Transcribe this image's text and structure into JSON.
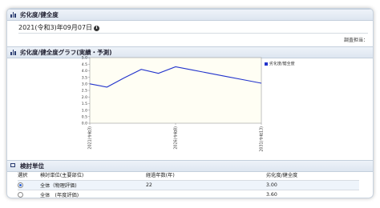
{
  "header": {
    "title": "劣化度/健全度"
  },
  "date_row": {
    "date": "2021(令和3)年09月07日",
    "info_icon": "info-icon"
  },
  "surveyor": {
    "label": "調査担当："
  },
  "chart_section": {
    "title": "劣化度/健全度グラフ(実績・予測)"
  },
  "chart_data": {
    "type": "line",
    "title": "",
    "xlabel": "",
    "ylabel": "",
    "x": [
      2021,
      2022,
      2023,
      2024,
      2025,
      2026,
      2027,
      2028,
      2029,
      2030,
      2031
    ],
    "x_ticks": [
      {
        "value": 2021,
        "label": "2021(令和3)"
      },
      {
        "value": 2026,
        "label": "2026(令和8)"
      },
      {
        "value": 2031,
        "label": "2031(令和13)"
      }
    ],
    "series": [
      {
        "name": "劣化度/健全度",
        "color": "#2233cc",
        "values": [
          3.0,
          2.75,
          3.45,
          4.1,
          3.8,
          4.3,
          4.05,
          3.8,
          3.55,
          3.3,
          3.05
        ]
      }
    ],
    "ylim": [
      0,
      5
    ],
    "y_ticks": [
      "0.0",
      "0.5",
      "1.0",
      "1.5",
      "2.0",
      "2.5",
      "3.0",
      "3.5",
      "4.0",
      "4.5",
      "5.0"
    ],
    "grid": false,
    "legend": "right",
    "plot_background": "#fffef4"
  },
  "units_section": {
    "title": "検討単位",
    "columns": [
      "選択",
      "検討単位(主要部位)",
      "経過年数(年)",
      "劣化度/健全度"
    ],
    "rows": [
      {
        "unit": "全体（物理評価)",
        "years": "22",
        "score": "3.00",
        "selected": true
      },
      {
        "unit": "全体　(年度評価)",
        "years": "",
        "score": "3.60",
        "selected": false
      }
    ]
  }
}
